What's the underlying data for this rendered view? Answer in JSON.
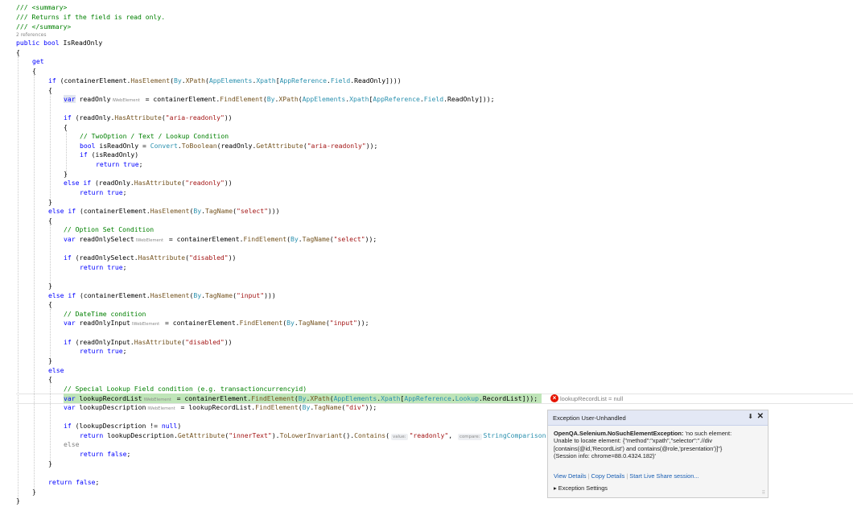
{
  "code": {
    "summary_open": "/// <summary>",
    "summary_text": "/// Returns if the field is read only.",
    "summary_close": "/// </summary>",
    "codelens": "2 references",
    "decl_public": "public",
    "decl_bool": "bool",
    "decl_name": " IsReadOnly",
    "open_brace": "{",
    "close_brace": "}",
    "get": "get",
    "hint_iwebelement": "IWebElement",
    "hint_value": "value:",
    "hint_compare": "compare:",
    "comment_twooption": "// TwoOption / Text / Lookup Condition",
    "comment_optionset": "// Option Set Condition",
    "comment_datetime": "// DateTime condition",
    "comment_special": "// Special Lookup Field condition (e.g. transactioncurrencyid)",
    "str_aria": "\"aria-readonly\"",
    "str_readonly": "\"readonly\"",
    "str_select": "\"select\"",
    "str_disabled": "\"disabled\"",
    "str_input": "\"input\"",
    "str_div": "\"div\"",
    "str_innertext": "\"innerText\"",
    "str_readonly_val": "\"readonly\"",
    "var_readonly": "readOnly",
    "var_readonlyselect": "readOnlySelect",
    "var_readonlyinput": "readOnlyInput",
    "var_lookuprecordlist": "lookupRecordList",
    "var_lookupdesc": "lookupDescription",
    "var_isreadonly": "isReadOnly"
  },
  "datatip": {
    "variable": "lookupRecordList",
    "value": "= null"
  },
  "exception_popup": {
    "title": "Exception User-Unhandled",
    "exception_type": "OpenQA.Selenium.NoSuchElementException:",
    "message_1": " 'no such element:",
    "message_2": "Unable to locate element: {\"method\":\"xpath\",\"selector\":\".//div",
    "message_3": "[contains(@id,'RecordList') and contains(@role,'presentation')]\"}",
    "message_4": "  (Session info: chrome=88.0.4324.182)'",
    "link_view": "View Details",
    "link_copy": "Copy Details",
    "link_share": "Start Live Share session...",
    "settings": "Exception Settings",
    "pin_icon": "pin-icon",
    "close_icon": "close-icon"
  },
  "colors": {
    "keyword": "#0000ff",
    "type": "#2b91af",
    "comment": "#008000",
    "string": "#a31515",
    "highlight": "#bfe5b8",
    "error": "#e51400"
  }
}
